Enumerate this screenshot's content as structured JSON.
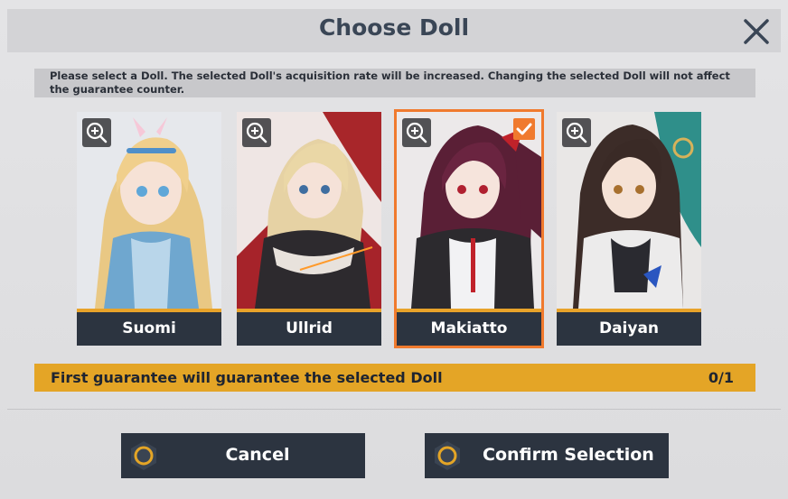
{
  "dialog": {
    "title": "Choose Doll",
    "notice": "Please select a Doll. The selected Doll's acquisition rate will be increased. Changing the selected Doll will not affect the guarantee counter."
  },
  "cards": [
    {
      "name": "Suomi",
      "selected": false
    },
    {
      "name": "Ullrid",
      "selected": false
    },
    {
      "name": "Makiatto",
      "selected": true
    },
    {
      "name": "Daiyan",
      "selected": false
    }
  ],
  "guarantee": {
    "text": "First guarantee will guarantee the selected Doll",
    "count": "0/1"
  },
  "buttons": {
    "cancel": "Cancel",
    "confirm": "Confirm Selection"
  },
  "colors": {
    "accent_orange": "#f07a2e",
    "guarantee_yellow": "#e4a526",
    "button_dark": "#2c3440"
  }
}
